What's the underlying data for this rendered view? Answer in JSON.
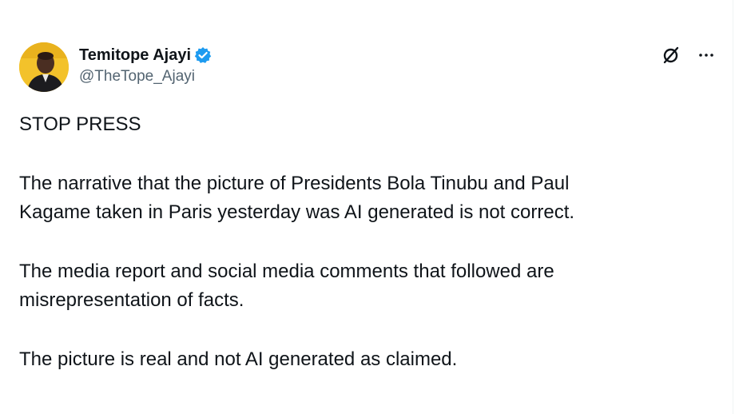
{
  "author": {
    "display_name": "Temitope Ajayi",
    "handle": "@TheTope_Ajayi",
    "verified": true,
    "avatar": "profile-photo"
  },
  "actions": {
    "grok_icon": "grok-icon",
    "more_icon": "more-options-icon"
  },
  "tweet": {
    "line1": "STOP PRESS",
    "para1_line1": "The narrative that the picture of Presidents Bola Tinubu and Paul",
    "para1_line2": "Kagame taken in Paris yesterday was AI generated is not correct.",
    "para2_line1": "The media report and social media comments that followed are",
    "para2_line2": "misrepresentation of facts.",
    "para3_line1": "The picture is real and not AI generated as claimed."
  },
  "colors": {
    "text": "#0f1419",
    "secondary": "#536471",
    "verified_blue": "#1d9bf0",
    "avatar_bg": "#f3c22b"
  }
}
